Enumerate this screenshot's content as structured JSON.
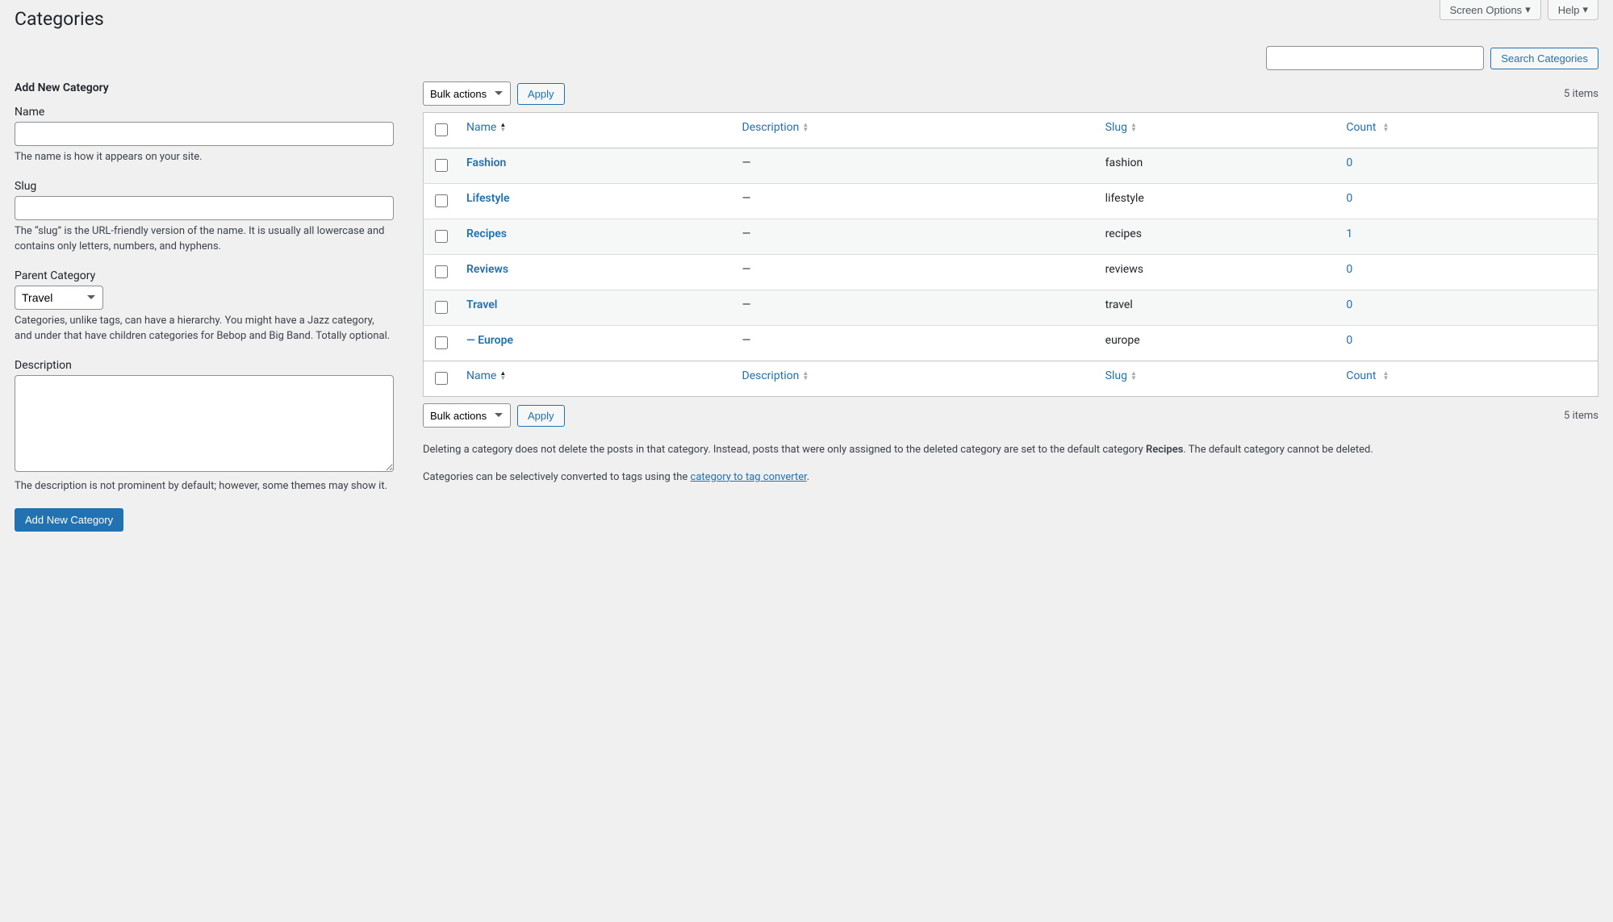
{
  "topbar": {
    "screen_options": "Screen Options",
    "help": "Help"
  },
  "page_title": "Categories",
  "search": {
    "value": "",
    "button": "Search Categories"
  },
  "form": {
    "heading": "Add New Category",
    "name": {
      "label": "Name",
      "value": "",
      "help": "The name is how it appears on your site."
    },
    "slug": {
      "label": "Slug",
      "value": "",
      "help": "The “slug” is the URL-friendly version of the name. It is usually all lowercase and contains only letters, numbers, and hyphens."
    },
    "parent": {
      "label": "Parent Category",
      "selected": "Travel",
      "help": "Categories, unlike tags, can have a hierarchy. You might have a Jazz category, and under that have children categories for Bebop and Big Band. Totally optional."
    },
    "description": {
      "label": "Description",
      "value": "",
      "help": "The description is not prominent by default; however, some themes may show it."
    },
    "submit": "Add New Category"
  },
  "bulk": {
    "selected": "Bulk actions",
    "apply": "Apply"
  },
  "pagination": {
    "items_text": "5 items"
  },
  "columns": {
    "name": "Name",
    "description": "Description",
    "slug": "Slug",
    "count": "Count"
  },
  "rows": [
    {
      "name": "Fashion",
      "description": "—",
      "slug": "fashion",
      "count": "0",
      "indent": 0
    },
    {
      "name": "Lifestyle",
      "description": "—",
      "slug": "lifestyle",
      "count": "0",
      "indent": 0
    },
    {
      "name": "Recipes",
      "description": "—",
      "slug": "recipes",
      "count": "1",
      "indent": 0
    },
    {
      "name": "Reviews",
      "description": "—",
      "slug": "reviews",
      "count": "0",
      "indent": 0
    },
    {
      "name": "Travel",
      "description": "—",
      "slug": "travel",
      "count": "0",
      "indent": 0
    },
    {
      "name": "— Europe",
      "description": "—",
      "slug": "europe",
      "count": "0",
      "indent": 0
    }
  ],
  "notes": {
    "line1_pre": "Deleting a category does not delete the posts in that category. Instead, posts that were only assigned to the deleted category are set to the default category ",
    "default_cat": "Recipes",
    "line1_post": ". The default category cannot be deleted.",
    "line2_pre": "Categories can be selectively converted to tags using the ",
    "converter_link": "category to tag converter",
    "line2_post": "."
  }
}
